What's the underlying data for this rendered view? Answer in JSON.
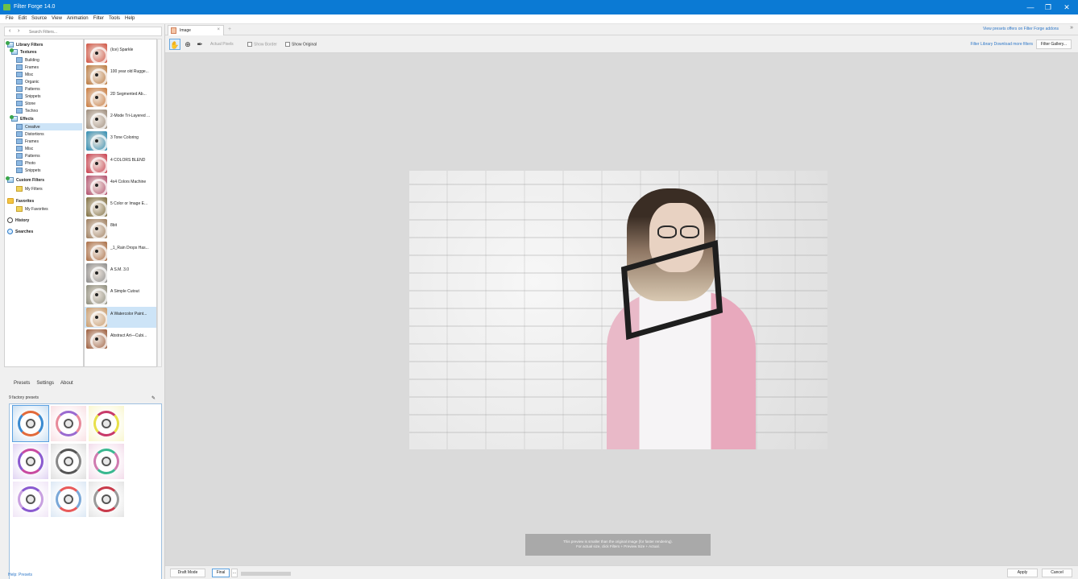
{
  "window": {
    "title": "Filter Forge 14.0",
    "controls": [
      "—",
      "❐",
      "✕"
    ]
  },
  "menu": [
    "File",
    "Edit",
    "Source",
    "View",
    "Animation",
    "Filter",
    "Tools",
    "Help"
  ],
  "search": {
    "back": "‹",
    "forward": "›",
    "placeholder": "Search Filters..."
  },
  "tree": [
    {
      "label": "Library Filters",
      "icon": "library-icon",
      "bold": true
    },
    {
      "label": "Textures",
      "icon": "library-icon",
      "bold": true
    },
    {
      "label": "Building",
      "icon": "folder-icon"
    },
    {
      "label": "Frames",
      "icon": "folder-icon"
    },
    {
      "label": "Misc",
      "icon": "folder-icon"
    },
    {
      "label": "Organic",
      "icon": "folder-icon"
    },
    {
      "label": "Patterns",
      "icon": "folder-icon"
    },
    {
      "label": "Snippets",
      "icon": "folder-icon"
    },
    {
      "label": "Stone",
      "icon": "folder-icon"
    },
    {
      "label": "Techno",
      "icon": "folder-icon"
    },
    {
      "label": "Effects",
      "icon": "library-icon",
      "bold": true
    },
    {
      "label": "Creative",
      "icon": "folder-icon",
      "selected": true
    },
    {
      "label": "Distortions",
      "icon": "folder-icon"
    },
    {
      "label": "Frames",
      "icon": "folder-icon"
    },
    {
      "label": "Misc",
      "icon": "folder-icon"
    },
    {
      "label": "Patterns",
      "icon": "folder-icon"
    },
    {
      "label": "Photo",
      "icon": "folder-icon"
    },
    {
      "label": "Snippets",
      "icon": "folder-icon"
    },
    {
      "label": "Custom Filters",
      "icon": "library-icon",
      "bold": true
    },
    {
      "label": "My Filters",
      "icon": "yellow-folder-icon"
    },
    {
      "label": "Favorites",
      "icon": "star-icon",
      "bold": true
    },
    {
      "label": "My Favorites",
      "icon": "yellow-folder-icon"
    },
    {
      "label": "History",
      "icon": "clock-icon",
      "bold": true
    },
    {
      "label": "Searches",
      "icon": "magnifier-icon",
      "bold": true
    }
  ],
  "filters": [
    {
      "name": "(Ice) Sparkle",
      "color": "#d05040"
    },
    {
      "name": "100 year old Rugge...",
      "color": "#b8763a"
    },
    {
      "name": "2D Segmented Ab...",
      "color": "#c8783a"
    },
    {
      "name": "2-Mode Tri-Layered ...",
      "color": "#9a8a7a"
    },
    {
      "name": "3 Tone Coloring",
      "color": "#2a8ab0"
    },
    {
      "name": "4 COLORS BLEND",
      "color": "#c83a4a"
    },
    {
      "name": "4x4 Colors Machine",
      "color": "#b04a6a"
    },
    {
      "name": "5 Color or Image E...",
      "color": "#7a6a3a"
    },
    {
      "name": "8bit",
      "color": "#9a7a5a"
    },
    {
      "name": "_1_Rain Drops Has...",
      "color": "#a86a40"
    },
    {
      "name": "A S.M. 3.0",
      "color": "#8a8a8a"
    },
    {
      "name": "A Simple Cutout",
      "color": "#8a8a7a"
    },
    {
      "name": "A Watercolor Paint...",
      "color": "#c89a6a",
      "selected": true
    },
    {
      "name": "Abstract Art—Cubi...",
      "color": "#9a5a3a"
    }
  ],
  "lower_tabs": [
    "Presets",
    "Settings",
    "About"
  ],
  "preset_count": "9 factory presets",
  "pin": "✎",
  "presets": [
    {
      "a": "#e26a3a",
      "b": "#3a8ad0",
      "selected": true
    },
    {
      "a": "#9a6ad0",
      "b": "#e88a9a"
    },
    {
      "a": "#c83a6a",
      "b": "#e8e04a"
    },
    {
      "a": "#c84aa0",
      "b": "#8a5ad0"
    },
    {
      "a": "#555555",
      "b": "#888888"
    },
    {
      "a": "#3ab890",
      "b": "#d07ab0"
    },
    {
      "a": "#8a5ad0",
      "b": "#c8a0e0"
    },
    {
      "a": "#e85a5a",
      "b": "#7aa8d8"
    },
    {
      "a": "#c83a4a",
      "b": "#9a9a9a"
    }
  ],
  "help_link": "Help: Presets",
  "doc_tab": {
    "label": "Image",
    "close": "×",
    "new": "+"
  },
  "online_link": "View presets offers on Filter Forge addons",
  "tab_chevron": "»",
  "toolbar": {
    "actual_pixels": "Actual Pixels",
    "show_border": "Show Border",
    "show_original": "Show Original",
    "links": "Filter Library   Download more filters",
    "gallery": "Filter Gallery..."
  },
  "preview_note": [
    "This preview is smaller than the original image (for faster rendering).",
    "For actual size, click Filters + Preview Size + Actual."
  ],
  "status": {
    "draft": "Draft Mode",
    "final": "Final",
    "more": "...",
    "apply": "Apply",
    "cancel": "Cancel"
  }
}
